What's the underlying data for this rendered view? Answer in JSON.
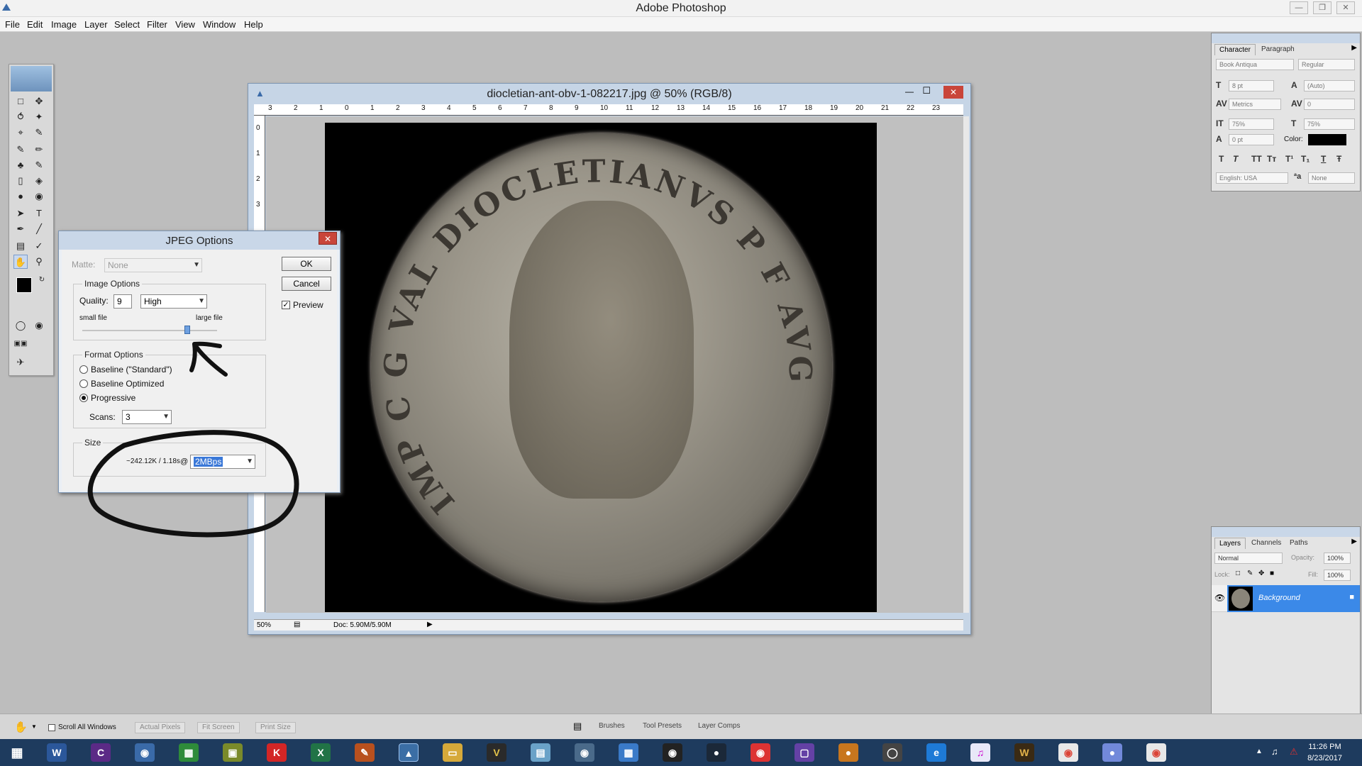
{
  "app": {
    "title": "Adobe Photoshop"
  },
  "menu": [
    "File",
    "Edit",
    "Image",
    "Layer",
    "Select",
    "Filter",
    "View",
    "Window",
    "Help"
  ],
  "document": {
    "title": "diocletian-ant-obv-1-082217.jpg @ 50% (RGB/8)",
    "zoom": "50%",
    "doc_size": "Doc: 5.90M/5.90M",
    "ruler_top": [
      "3",
      "2",
      "1",
      "0",
      "1",
      "2",
      "3",
      "4",
      "5",
      "6",
      "7",
      "8",
      "9",
      "10",
      "11",
      "12",
      "13",
      "14",
      "15",
      "16",
      "17",
      "18",
      "19",
      "20",
      "21",
      "22",
      "23"
    ],
    "ruler_left": [
      "0",
      "1",
      "2",
      "3"
    ],
    "coin_inscription": "IMP C G VAL DIOCLETIANVS P F AVG"
  },
  "jpeg_dialog": {
    "title": "JPEG Options",
    "matte_label": "Matte:",
    "matte_value": "None",
    "ok_label": "OK",
    "cancel_label": "Cancel",
    "preview_label": "Preview",
    "preview_checked": true,
    "image_options_label": "Image Options",
    "quality_label": "Quality:",
    "quality_value": "9",
    "quality_preset": "High",
    "small_file_label": "small file",
    "large_file_label": "large file",
    "format_options_label": "Format Options",
    "formats": [
      "Baseline (\"Standard\")",
      "Baseline Optimized",
      "Progressive"
    ],
    "selected_format": "Progressive",
    "scans_label": "Scans:",
    "scans_value": "3",
    "size_label": "Size",
    "size_estimate": "~242.12K / 1.18s",
    "at_symbol": "@",
    "speed_value": "2MBps"
  },
  "character_panel": {
    "tabs": [
      "Character",
      "Paragraph"
    ],
    "font_family": "Book Antiqua",
    "font_style": "Regular",
    "font_size": "8 pt",
    "leading": "(Auto)",
    "kerning": "Metrics",
    "tracking": "0",
    "vertical_scale": "75%",
    "horizontal_scale": "75%",
    "baseline_shift": "0 pt",
    "color_label": "Color:",
    "text_style_buttons": [
      "T",
      "T",
      "TT",
      "Tт",
      "T¹",
      "T₁",
      "T",
      "Ŧ"
    ],
    "language": "English: USA",
    "aa_label": "ªa",
    "anti_alias": "None"
  },
  "layers_panel": {
    "tabs": [
      "Layers",
      "Channels",
      "Paths"
    ],
    "blend_mode": "Normal",
    "opacity_label": "Opacity:",
    "opacity_value": "100%",
    "lock_label": "Lock:",
    "fill_label": "Fill:",
    "fill_value": "100%",
    "layer_name": "Background"
  },
  "options_bar": {
    "scroll_all": "Scroll All Windows",
    "buttons": [
      "Actual Pixels",
      "Fit Screen",
      "Print Size"
    ],
    "dock_tabs": [
      "Brushes",
      "Tool Presets",
      "Layer Comps"
    ]
  },
  "taskbar": {
    "time": "11:26 PM",
    "date": "8/23/2017"
  },
  "colors": {
    "dialog_title_bg": "#c9d7e8",
    "selection_blue": "#3a78d8",
    "layer_highlight": "#3b89e8",
    "taskbar": "#1e3b5e",
    "annotation_ink": "#111111"
  }
}
